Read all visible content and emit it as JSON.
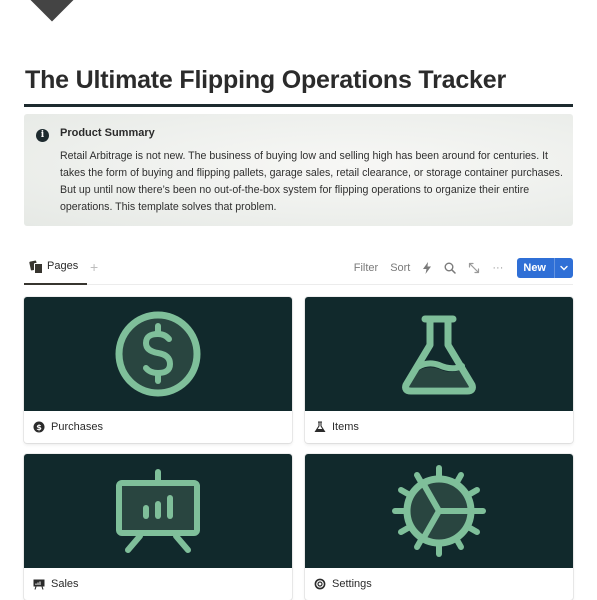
{
  "page": {
    "title": "The Ultimate Flipping Operations Tracker",
    "logo_icon": "diamond-logo-icon"
  },
  "callout": {
    "icon": "info-icon",
    "icon_glyph": "i",
    "title": "Product Summary",
    "body": "Retail Arbitrage is not new. The business of buying low and selling high has been around for centuries. It takes the form of buying and flipping pallets, garage sales, retail clearance, or storage container purchases. But up until now there’s been no out-of-the-box system for flipping operations to organize their entire operations. This template solves that problem."
  },
  "database": {
    "view_tab": {
      "label": "Pages",
      "icon": "pages-icon"
    },
    "add_view_glyph": "+",
    "toolbar": {
      "filter_label": "Filter",
      "sort_label": "Sort",
      "automation_icon": "lightning-icon",
      "search_icon": "search-icon",
      "expand_icon": "expand-icon",
      "more_glyph": "···",
      "new_label": "New",
      "new_caret_icon": "chevron-down-icon"
    },
    "cards": [
      {
        "label": "Purchases",
        "icon": "dollar-circle-icon"
      },
      {
        "label": "Items",
        "icon": "flask-icon"
      },
      {
        "label": "Sales",
        "icon": "presentation-chart-icon"
      },
      {
        "label": "Settings",
        "icon": "gear-icon"
      }
    ]
  },
  "colors": {
    "cover_bg": "#11292c",
    "icon_green": "#7fbf9a",
    "icon_fill": "#294540",
    "accent_blue": "#2f6fd6",
    "title_rule": "#1d2a2e"
  }
}
